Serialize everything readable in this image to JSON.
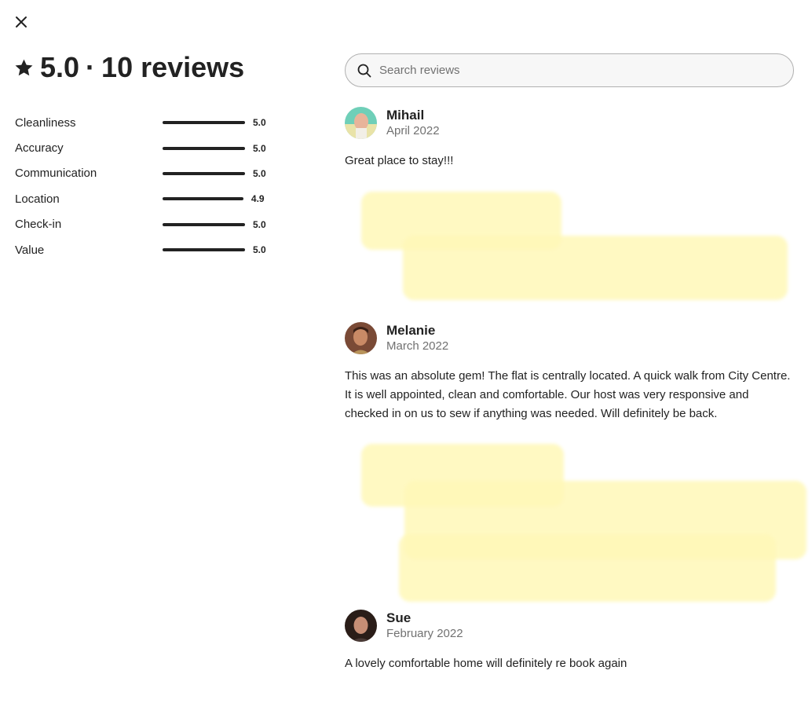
{
  "icons": {
    "close": "close-icon",
    "star": "star-icon",
    "search": "search-icon"
  },
  "colors": {
    "text": "#222222",
    "muted": "#717171",
    "highlight": "#fff8b8"
  },
  "summary": {
    "rating": "5.0",
    "separator": "·",
    "review_count": "10 reviews"
  },
  "ratings": [
    {
      "label": "Cleanliness",
      "value": "5.0",
      "level": 1.0
    },
    {
      "label": "Accuracy",
      "value": "5.0",
      "level": 1.0
    },
    {
      "label": "Communication",
      "value": "5.0",
      "level": 1.0
    },
    {
      "label": "Location",
      "value": "4.9",
      "level": 0.98
    },
    {
      "label": "Check-in",
      "value": "5.0",
      "level": 1.0
    },
    {
      "label": "Value",
      "value": "5.0",
      "level": 1.0
    }
  ],
  "search": {
    "placeholder": "Search reviews",
    "value": ""
  },
  "reviews": [
    {
      "name": "Mihail",
      "date": "April 2022",
      "text": "Great place to stay!!!"
    },
    {
      "name": "Melanie",
      "date": "March 2022",
      "text": "This was an absolute gem! The flat is centrally located. A quick walk from City Centre. It is well appointed, clean and comfortable. Our host was very responsive and checked in on us to sew if anything was needed. Will definitely be back."
    },
    {
      "name": "Sue",
      "date": "February 2022",
      "text": "A lovely comfortable home will definitely re book again"
    }
  ]
}
